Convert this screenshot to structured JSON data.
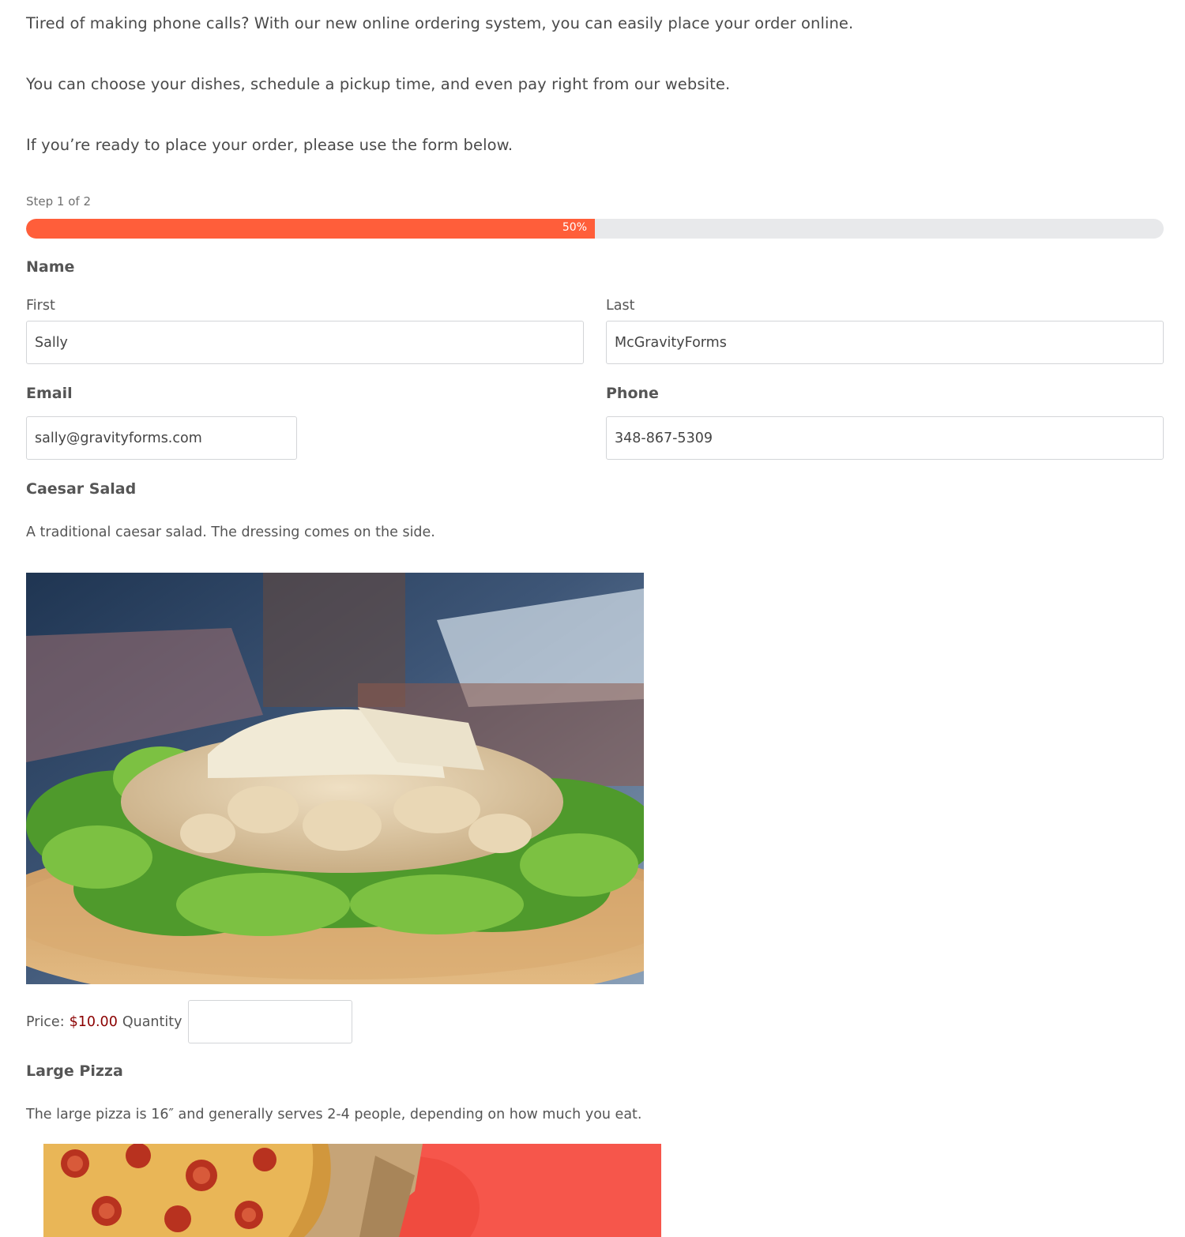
{
  "intro": {
    "p1": "Tired of making phone calls? With our new online ordering system, you can easily place your order online.",
    "p2": "You can choose your dishes, schedule a pickup time, and even pay right from our website.",
    "p3": "If you’re ready to place your order, please use the form below."
  },
  "progress": {
    "step_text": "Step 1 of 2",
    "percent_label": "50%",
    "percent": 50,
    "fill_color": "#ff5e3a"
  },
  "form": {
    "name": {
      "label": "Name",
      "first_label": "First",
      "first_value": "Sally",
      "last_label": "Last",
      "last_value": "McGravityForms"
    },
    "email": {
      "label": "Email",
      "value": "sally@gravityforms.com"
    },
    "phone": {
      "label": "Phone",
      "value": "348-867-5309"
    }
  },
  "products": [
    {
      "title": "Caesar Salad",
      "description": "A traditional caesar salad. The dressing comes on the side.",
      "price_label": "Price:",
      "price": "$10.00",
      "quantity_label": "Quantity",
      "quantity_value": ""
    },
    {
      "title": "Large Pizza",
      "description": "The large pizza is 16″ and generally serves 2-4 people, depending on how much you eat."
    }
  ]
}
